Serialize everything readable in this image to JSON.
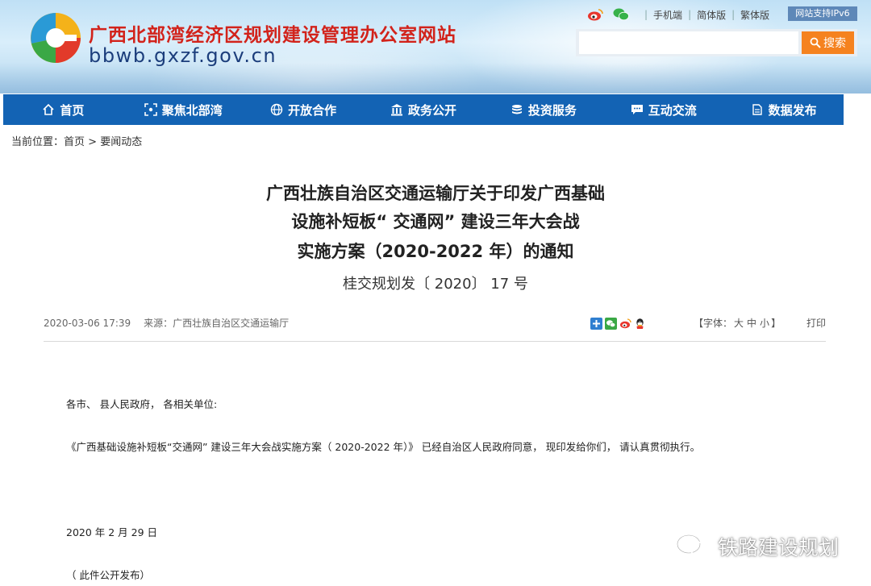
{
  "header": {
    "site_title": "广西北部湾经济区规划建设管理办公室网站",
    "site_domain": "bbwb.gxzf.gov.cn",
    "top_links": [
      "手机端",
      "简体版",
      "繁体版"
    ],
    "ipv6_badge": "网站支持IPv6",
    "search": {
      "placeholder": "",
      "button_label": "搜索"
    }
  },
  "nav": [
    {
      "label": "首页",
      "icon": "home-icon"
    },
    {
      "label": "聚焦北部湾",
      "icon": "focus-icon"
    },
    {
      "label": "开放合作",
      "icon": "globe-icon"
    },
    {
      "label": "政务公开",
      "icon": "building-icon"
    },
    {
      "label": "投资服务",
      "icon": "coins-icon"
    },
    {
      "label": "互动交流",
      "icon": "chat-icon"
    },
    {
      "label": "数据发布",
      "icon": "data-icon"
    }
  ],
  "breadcrumb": {
    "prefix": "当前位置：",
    "home": "首页",
    "separator": " > ",
    "current": "要闻动态"
  },
  "article": {
    "title_lines": [
      "广西壮族自治区交通运输厅关于印发广西基础",
      "设施补短板“ 交通网” 建设三年大会战",
      "实施方案（2020-2022 年）的通知"
    ],
    "doc_number": "桂交规划发〔 2020〕 17 号",
    "date": "2020-03-06 17:39",
    "source": "来源：广西壮族自治区交通运输厅",
    "font_size_label": "【字体：",
    "font_sizes": [
      "大",
      "中",
      "小"
    ],
    "font_size_end": "】",
    "print": "打印",
    "paragraphs": [
      "各市、 县人民政府， 各相关单位:",
      "《广西基础设施补短板“交通网” 建设三年大会战实施方案（ 2020-2022 年）》 已经自治区人民政府同意， 现印发给你们， 请认真贯彻执行。",
      "2020 年 2 月 29 日",
      "（ 此件公开发布）"
    ]
  },
  "watermark": "铁路建设规划",
  "colors": {
    "nav": "#1363b4",
    "title_red": "#d2231b",
    "search_orange": "#f5821f",
    "domain_blue": "#1c3e7c"
  }
}
